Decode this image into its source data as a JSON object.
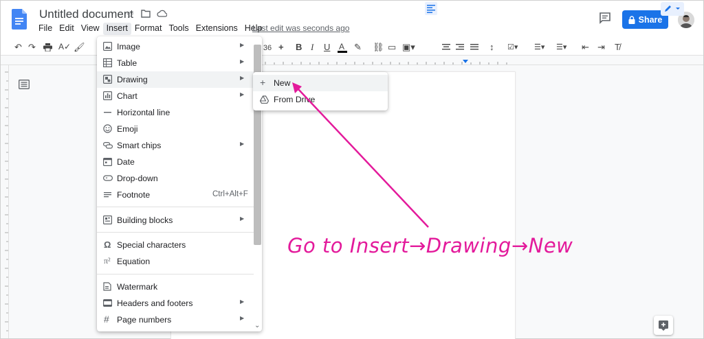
{
  "document": {
    "title": "Untitled document",
    "last_edit": "Last edit was seconds ago"
  },
  "menubar": {
    "items": [
      "File",
      "Edit",
      "View",
      "Insert",
      "Format",
      "Tools",
      "Extensions",
      "Help"
    ],
    "active": "Insert"
  },
  "share": {
    "label": "Share"
  },
  "toolbar": {
    "font_size": "36"
  },
  "insert_menu": {
    "items": [
      {
        "label": "Image",
        "icon": "image-icon",
        "submenu": true
      },
      {
        "label": "Table",
        "icon": "table-icon",
        "submenu": true
      },
      {
        "label": "Drawing",
        "icon": "drawing-icon",
        "submenu": true,
        "highlighted": true
      },
      {
        "label": "Chart",
        "icon": "chart-icon",
        "submenu": true
      },
      {
        "label": "Horizontal line",
        "icon": "horizontal-line-icon"
      },
      {
        "label": "Emoji",
        "icon": "emoji-icon"
      },
      {
        "label": "Smart chips",
        "icon": "smart-chips-icon",
        "submenu": true
      },
      {
        "label": "Date",
        "icon": "date-icon"
      },
      {
        "label": "Drop-down",
        "icon": "dropdown-icon"
      },
      {
        "label": "Footnote",
        "icon": "footnote-icon",
        "shortcut": "Ctrl+Alt+F"
      },
      {
        "label": "Building blocks",
        "icon": "building-blocks-icon",
        "submenu": true
      },
      {
        "label": "Special characters",
        "icon": "omega-icon"
      },
      {
        "label": "Equation",
        "icon": "pi-icon"
      },
      {
        "label": "Watermark",
        "icon": "watermark-icon"
      },
      {
        "label": "Headers and footers",
        "icon": "headers-footers-icon",
        "submenu": true
      },
      {
        "label": "Page numbers",
        "icon": "hash-icon",
        "submenu": true
      }
    ]
  },
  "drawing_submenu": {
    "items": [
      {
        "label": "New",
        "icon": "plus-icon",
        "highlighted": true
      },
      {
        "label": "From Drive",
        "icon": "drive-icon"
      }
    ]
  },
  "annotation": {
    "text": "Go to Insert→Drawing→New",
    "color": "#e31a9b"
  },
  "colors": {
    "accent": "#1a73e8",
    "doc_icon": "#4285f4",
    "highlight": "#f1f3f4"
  }
}
